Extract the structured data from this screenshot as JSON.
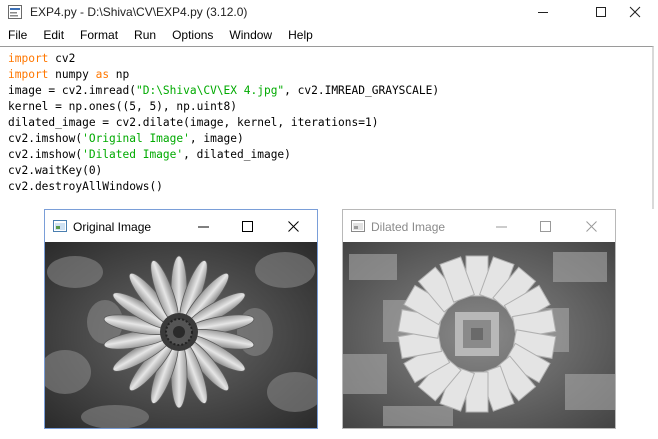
{
  "window": {
    "title": "EXP4.py - D:\\Shiva\\CV\\EXP4.py (3.12.0)",
    "icons": {
      "app": "python-idle-icon",
      "minimize": "minimize-icon",
      "maximize": "maximize-icon",
      "close": "close-icon"
    }
  },
  "menu": [
    "File",
    "Edit",
    "Format",
    "Run",
    "Options",
    "Window",
    "Help"
  ],
  "code": {
    "lines": [
      [
        {
          "t": "import",
          "c": "kw"
        },
        {
          "t": " cv2"
        }
      ],
      [
        {
          "t": "import",
          "c": "kw"
        },
        {
          "t": " numpy "
        },
        {
          "t": "as",
          "c": "kw"
        },
        {
          "t": " np"
        }
      ],
      [
        {
          "t": "image = cv2.imread("
        },
        {
          "t": "\"D:\\Shiva\\CV\\EX 4.jpg\"",
          "c": "str"
        },
        {
          "t": ", cv2.IMREAD_GRAYSCALE)"
        }
      ],
      [
        {
          "t": "kernel = np.ones((5, 5), np.uint8)"
        }
      ],
      [
        {
          "t": "dilated_image = cv2.dilate(image, kernel, iterations=1)"
        }
      ],
      [
        {
          "t": "cv2.imshow("
        },
        {
          "t": "'Original Image'",
          "c": "str"
        },
        {
          "t": ", image)"
        }
      ],
      [
        {
          "t": "cv2.imshow("
        },
        {
          "t": "'Dilated Image'",
          "c": "str"
        },
        {
          "t": ", dilated_image)"
        }
      ],
      [
        {
          "t": "cv2.waitKey(0)"
        }
      ],
      [
        {
          "t": "cv2.destroyAllWindows()"
        }
      ]
    ],
    "colors": {
      "keyword": "#ff7700",
      "string": "#00aa00",
      "text": "#000000"
    }
  },
  "windows": {
    "original": {
      "title": "Original Image",
      "active": true,
      "icon": "image-window-icon"
    },
    "dilated": {
      "title": "Dilated Image",
      "active": false,
      "icon": "image-window-icon"
    }
  }
}
